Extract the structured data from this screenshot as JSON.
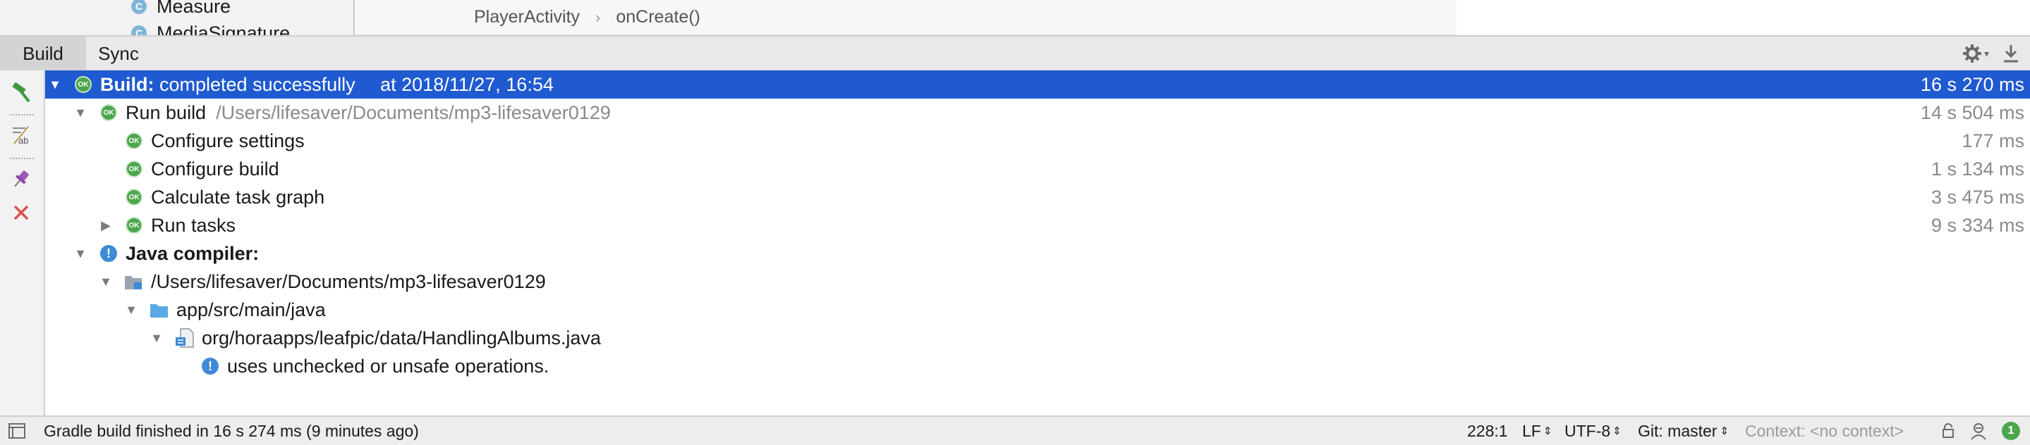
{
  "project_tree": {
    "items": [
      {
        "label": "Measure",
        "icon": "class-icon",
        "icon_letter": "C"
      },
      {
        "label": "MediaSignature",
        "icon": "class-icon",
        "icon_letter": "C"
      }
    ]
  },
  "breadcrumb": {
    "items": [
      "PlayerActivity",
      "onCreate()"
    ],
    "separator": "›"
  },
  "tool_window": {
    "tabs": [
      {
        "label": "Build",
        "active": true
      },
      {
        "label": "Sync",
        "active": false
      }
    ],
    "settings_icon": "gear-icon",
    "download_icon": "download-icon"
  },
  "left_toolbar": {
    "buttons": [
      "hammer-icon",
      "text-format-icon",
      "pin-icon",
      "close-icon"
    ]
  },
  "build_tree": {
    "root": {
      "label_bold": "Build:",
      "label": "completed successfully",
      "timestamp": "at 2018/11/27, 16:54",
      "time": "16 s 270 ms",
      "status_icon": "ok-icon",
      "expanded": true
    },
    "run_build": {
      "label": "Run build",
      "path": "/Users/lifesaver/Documents/mp3-lifesaver0129",
      "time": "14 s 504 ms",
      "expanded": true
    },
    "tasks": [
      {
        "label": "Configure settings",
        "time": "177 ms",
        "expandable": false
      },
      {
        "label": "Configure build",
        "time": "1 s 134 ms",
        "expandable": false
      },
      {
        "label": "Calculate task graph",
        "time": "3 s 475 ms",
        "expandable": false
      },
      {
        "label": "Run tasks",
        "time": "9 s 334 ms",
        "expandable": true
      }
    ],
    "java_compiler": {
      "label": "Java compiler:",
      "status_icon": "info-icon",
      "project_path": "/Users/lifesaver/Documents/mp3-lifesaver0129",
      "source_dir": "app/src/main/java",
      "file": "org/horaapps/leafpic/data/HandlingAlbums.java",
      "message": "uses unchecked or unsafe operations."
    },
    "ok_badge_text": "OK"
  },
  "status_bar": {
    "message": "Gradle build finished in 16 s 274 ms (9 minutes ago)",
    "position": "228:1",
    "line_separator": "LF",
    "encoding": "UTF-8",
    "vcs": "Git: master",
    "context": "Context: <no context>",
    "notifications_count": "1"
  },
  "colors": {
    "selection": "#1f5ad1",
    "ok_green": "#4ca64c",
    "info_blue": "#3f8ad8",
    "error_red": "#d9534f"
  }
}
